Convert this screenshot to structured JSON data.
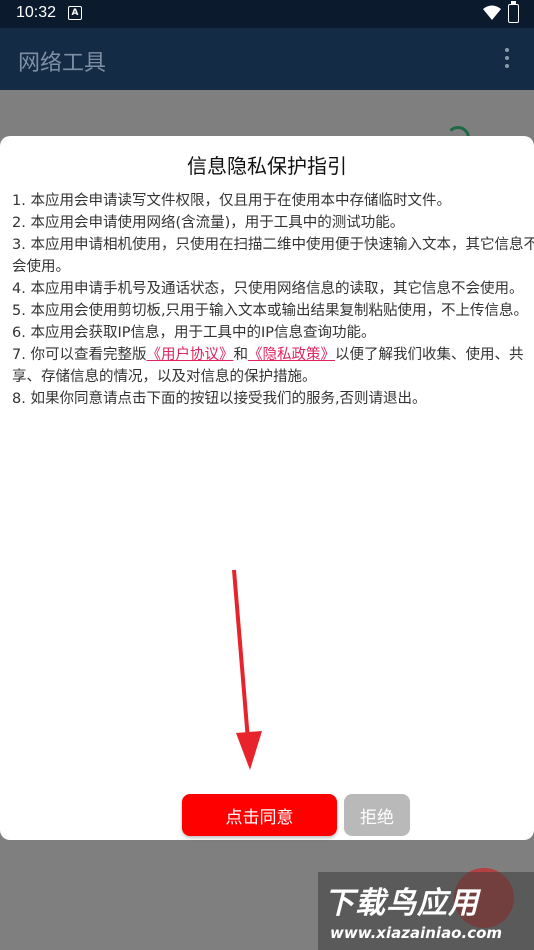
{
  "status_bar": {
    "time": "10:32",
    "notification_icon": "a-icon",
    "wifi_icon": "wifi-icon",
    "battery_icon": "battery-icon"
  },
  "app_bar": {
    "title": "网络工具",
    "menu_icon": "more-vert-icon"
  },
  "dialog": {
    "title": "信息隐私保护指引",
    "items": [
      "1. 本应用会申请读写文件权限，仅且用于在使用本中存储临时文件。",
      "2. 本应用会申请使用网络(含流量)，用于工具中的测试功能。",
      "3. 本应用申请相机使用，只使用在扫描二维中使用便于快速输入文本，其它信息不会使用。",
      "4. 本应用申请手机号及通话状态，只使用网络信息的读取，其它信息不会使用。",
      "5. 本应用会使用剪切板,只用于输入文本或输出结果复制粘贴使用，不上传信息。",
      "6. 本应用会获取IP信息，用于工具中的IP信息查询功能。"
    ],
    "item7": {
      "prefix": "7. 你可以查看完整版",
      "link1": "《用户协议》",
      "mid": "和",
      "link2": "《隐私政策》",
      "suffix": "以便了解我们收集、使用、共享、存储信息的情况，以及对信息的保护措施。"
    },
    "item8": "8. 如果你同意请点击下面的按钮以接受我们的服务,否则请退出。",
    "agree_label": "点击同意",
    "reject_label": "拒绝"
  },
  "watermark": {
    "name": "下载鸟应用",
    "url": "www.xiazainiao.com"
  },
  "colors": {
    "agree_button": "#ff0000",
    "reject_button": "#b9b9b9",
    "link": "#e0245e",
    "app_bar": "#142b45",
    "arrow": "#e8232b"
  }
}
